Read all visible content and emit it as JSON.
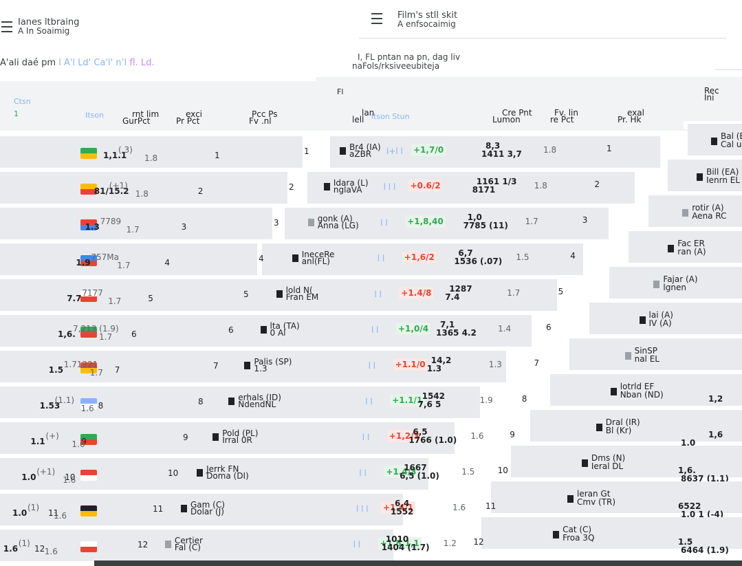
{
  "left_panel": {
    "title_line1": "Ianes ltbraing",
    "title_line2": "A In Soaimig",
    "faded_title": "",
    "subtitle": "A'ali daé pm",
    "subtitle_link": "l A'l Ld' Ca'l' n’l",
    "subtitle_suffix": "fl. Ld.",
    "col_link": "Ctsn",
    "col_badge": "1",
    "header_country": "Itson",
    "header_a": "rnt lim",
    "header_b": "GurPct",
    "header_c": "exci",
    "header_d": "Pr Pct",
    "header_e": "Pcc Ps",
    "header_f": "Fv .nl",
    "rows": [
      {
        "rank": "1",
        "value": "1,1.1",
        "delta": "(.3)",
        "pct": "1.8",
        "flag": [
          "#34a853",
          "#fbbc04"
        ]
      },
      {
        "rank": "2",
        "value": "81/15.2",
        "delta": "(+1)",
        "pct": "1.8",
        "flag": [
          "#fbbc04",
          "#ea4335"
        ]
      },
      {
        "rank": "3",
        "value": "1.3",
        "delta": "7789",
        "pct": "1.7",
        "flag": [
          "#ea4335",
          "#4285f4"
        ]
      },
      {
        "rank": "4",
        "value": "1.9",
        "delta": "757Ma",
        "pct": "1.7",
        "flag": [
          "#4285f4",
          "#ea4335"
        ]
      },
      {
        "rank": "5",
        "value": "7.7",
        "delta": "7177",
        "pct": "1.7",
        "flag": [
          "#ffffff",
          "#ea4335"
        ]
      },
      {
        "rank": "6",
        "value": "1,6.",
        "delta": "7,213 (1.9)",
        "pct": "1.7",
        "flag": [
          "#34a853",
          "#ea4335"
        ]
      },
      {
        "rank": "7",
        "value": "1.5",
        "delta": "1.71221",
        "pct": "1.7",
        "flag": [
          "#ea4335",
          "#fbbc04"
        ]
      },
      {
        "rank": "8",
        "value": "1.53",
        "delta": "(1.1)",
        "pct": "1.6",
        "flag": [
          "#8ab4f8",
          "#ffffff"
        ]
      },
      {
        "rank": "9",
        "value": "1.1",
        "delta": "(+)",
        "pct": "1.6",
        "flag": [
          "#34a853",
          "#ea4335"
        ]
      },
      {
        "rank": "10",
        "value": "1.0",
        "delta": "(+1)",
        "pct": "1.6",
        "flag": [
          "#ea4335",
          "#ffffff"
        ]
      },
      {
        "rank": "11",
        "value": "1.0",
        "delta": "(1)",
        "pct": "1.6",
        "flag": [
          "#202124",
          "#fbbc04"
        ]
      },
      {
        "rank": "12",
        "value": "1.6",
        "delta": "(1)",
        "pct": "1.6",
        "flag": [
          "#ffffff",
          "#ea4335"
        ]
      }
    ]
  },
  "right_panel": {
    "title_line1": "Film's stll skit",
    "title_line2": "A enfsocaimig",
    "subtitle_line1": "I, FL pntan na pn, dag liv",
    "subtitle_line2": "naFols/rksiveeubiteja",
    "col_rank": "Fl",
    "col_team": "lan",
    "col_team2": "lell",
    "col_link": "ltson Stun",
    "col_cur": "Cre Pnt",
    "col_cur2": "Lumon",
    "col_prev": "Fv. lin",
    "col_prev2": "re Pct",
    "col_ext": "exal",
    "col_ext2": "Pr. Hk",
    "col_r": "Rec",
    "col_r2": "Ini",
    "rows": [
      {
        "rank": "1",
        "team": "Br4 (IA)",
        "team2": "aZBR",
        "link": "l+l l",
        "change": "+1,7/0",
        "cur": "8,3",
        "cur2": "1411 3,7",
        "prev": "1.8",
        "rrank": "1",
        "rteam": "Bal (EA)",
        "rteam2": "Cal u"
      },
      {
        "rank": "2",
        "team": "Idara (L)",
        "team2": "nglaVA",
        "link": "l l l",
        "change": "+0.6/2",
        "cur": "1161 1/3",
        "cur2": "8171",
        "prev": "1.8",
        "rrank": "2",
        "rteam": "Bill (EA)",
        "rteam2": "Ienrn EL"
      },
      {
        "rank": "3",
        "team": "gonk (A)",
        "team2": "Anna (LG)",
        "link": "l l",
        "change": "+1,8,40",
        "cur": "1,0",
        "cur2": "7785 (11)",
        "prev": "1.7",
        "rrank": "3",
        "rteam": "rotir (A)",
        "rteam2": "Aena RC"
      },
      {
        "rank": "4",
        "team": "IneceRe",
        "team2": "anl(FL)",
        "link": "l l",
        "change": "+1,6/2",
        "cur": "6,7",
        "cur2": "1536 (.07)",
        "prev": "1.5",
        "rrank": "4",
        "rteam": "Fac ER",
        "rteam2": "ran (A)"
      },
      {
        "rank": "5",
        "team": "lold N(",
        "team2": "Fran EM",
        "link": "l l",
        "change": "+1.4/8",
        "cur": "1287",
        "cur2": "7.4",
        "prev": "1.7",
        "rrank": "5",
        "rteam": "Fajar (A)",
        "rteam2": "lgnen"
      },
      {
        "rank": "6",
        "team": "lta (TA)",
        "team2": "0 Al",
        "link": "l l",
        "change": "+1,0/4",
        "cur": "7,1",
        "cur2": "1365 4.2",
        "prev": "1.4",
        "rrank": "6",
        "rteam": "lai (A)",
        "rteam2": "IV (A)"
      },
      {
        "rank": "7",
        "team": "Palis (SP)",
        "team2": "1.3",
        "link": "l l",
        "change": "+1.1/0",
        "cur": "14,2",
        "cur2": "1.3",
        "prev": "1.3",
        "rrank": "7",
        "rteam": "SinSP",
        "rteam2": "nal EL"
      },
      {
        "rank": "8",
        "team": "erhals (ID)",
        "team2": "NdendNL",
        "link": "l l",
        "change": "+1.1/1",
        "cur": "1542",
        "cur2": "7,6 5",
        "prev": "1.9",
        "rrank": "8",
        "rteam": "lotrld EF",
        "rteam2": "Nban (ND)"
      },
      {
        "rank": "9",
        "team": "Pold (PL)",
        "team2": "Irral 0R",
        "link": "l l",
        "change": "+1,2/3",
        "cur": "6,5",
        "cur2": "1766 (1.0)",
        "prev": "1.6",
        "rrank": "9",
        "rteam": "Dral (IR)",
        "rteam2": "Bl (Kr)"
      },
      {
        "rank": "10",
        "team": "Jerrk FN",
        "team2": "Doma (DI)",
        "link": "l l",
        "change": "+1.4/3",
        "cur": "1667",
        "cur2": "6,5 (1.0)",
        "prev": "1.5",
        "rrank": "10",
        "rteam": "Dms (N)",
        "rteam2": "Ieral DL"
      },
      {
        "rank": "11",
        "team": "Gam (C)",
        "team2": "Dolar (J)",
        "link": "l l l",
        "change": "+1.4/1",
        "cur": "6,4",
        "cur2": "1552",
        "prev": "1.6",
        "rrank": "11",
        "rteam": "leran Gt",
        "rteam2": "Cmv (TR)"
      },
      {
        "rank": "12",
        "team": "Certier",
        "team2": "Fal (C)",
        "link": "l l",
        "change": "+1.8,1,1",
        "cur": "1010",
        "cur2": "1404 (1.7)",
        "prev": "1.2",
        "rrank": "12",
        "rteam": "Cat (C)",
        "rteam2": "Froa 3Q"
      }
    ],
    "right_values": [
      {
        "a": "",
        "b": ""
      },
      {
        "a": "",
        "b": ""
      },
      {
        "a": "",
        "b": ""
      },
      {
        "a": "",
        "b": ""
      },
      {
        "a": "",
        "b": ""
      },
      {
        "a": "",
        "b": ""
      },
      {
        "a": "",
        "b": ""
      },
      {
        "a": "1,2",
        "b": ""
      },
      {
        "a": "1,6",
        "b": "1.0"
      },
      {
        "a": "1,6.",
        "b": "8637 (1.1)"
      },
      {
        "a": "6522",
        "b": "1.0 1 (-4)"
      },
      {
        "a": "1.5",
        "b": "6464 (1.9)"
      }
    ]
  }
}
